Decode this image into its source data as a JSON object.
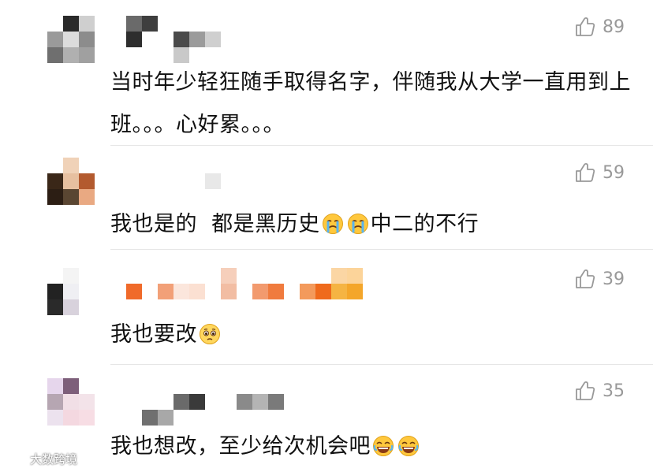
{
  "comments": [
    {
      "likes": "89",
      "text": "当时年少轻狂随手取得名字，伴随我从大学一直用到上班。。。心好累。。。"
    },
    {
      "likes": "59",
      "text_before": "我也是的  都是黑历史",
      "emojis": [
        "crying-emoji",
        "crying-emoji"
      ],
      "text_after": "中二的不行"
    },
    {
      "likes": "39",
      "text_before": "我也要改",
      "emojis": [
        "pleading-emoji"
      ],
      "text_after": ""
    },
    {
      "likes": "35",
      "text_before": "我也想改，至少给次机会吧",
      "emojis": [
        "laughing-tears-emoji",
        "laughing-tears-emoji"
      ],
      "text_after": ""
    }
  ],
  "icons": {
    "like": "thumbs-up-icon"
  },
  "watermark": {
    "text": "大数跨境"
  },
  "colors": {
    "like_gray": "#999999",
    "text": "#111111",
    "divider": "#e6e6e6"
  }
}
